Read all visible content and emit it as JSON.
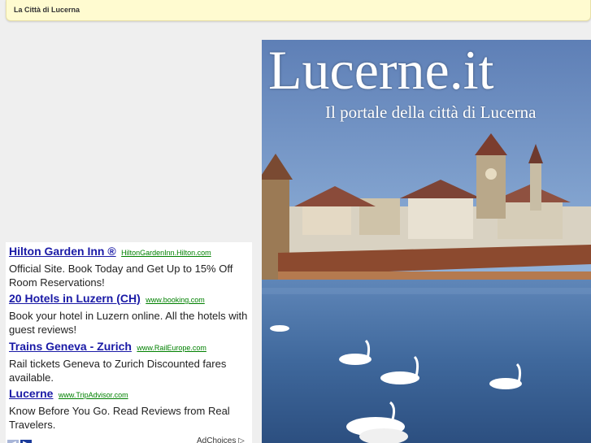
{
  "header": {
    "title": "La Città di Lucerna"
  },
  "hero": {
    "title": "Lucerne.it",
    "subtitle": "Il portale della città di Lucerna"
  },
  "ads": {
    "items": [
      {
        "title": "Hilton Garden Inn ®",
        "url": "HiltonGardenInn.Hilton.com",
        "desc": "Official Site. Book Today and Get Up to 15% Off Room Reservations!"
      },
      {
        "title": "20 Hotels in Luzern (CH)",
        "url": "www.booking.com",
        "desc": "Book your hotel in Luzern online. All the hotels with guest reviews!"
      },
      {
        "title": "Trains Geneva - Zurich",
        "url": "www.RailEurope.com",
        "desc": "Rail tickets Geneva to Zurich Discounted fares available."
      },
      {
        "title": "Lucerne",
        "url": "www.TripAdvisor.com",
        "desc": "Know Before You Go. Read Reviews from Real Travelers."
      }
    ],
    "adchoices_label": "AdChoices",
    "nav_prev_icon": "chevron-left-icon",
    "nav_next_icon": "chevron-right-icon"
  },
  "colors": {
    "header_bg": "#fffbd0",
    "ad_title": "#1a1aa6",
    "ad_url": "#008000",
    "page_bg": "#efefef"
  }
}
